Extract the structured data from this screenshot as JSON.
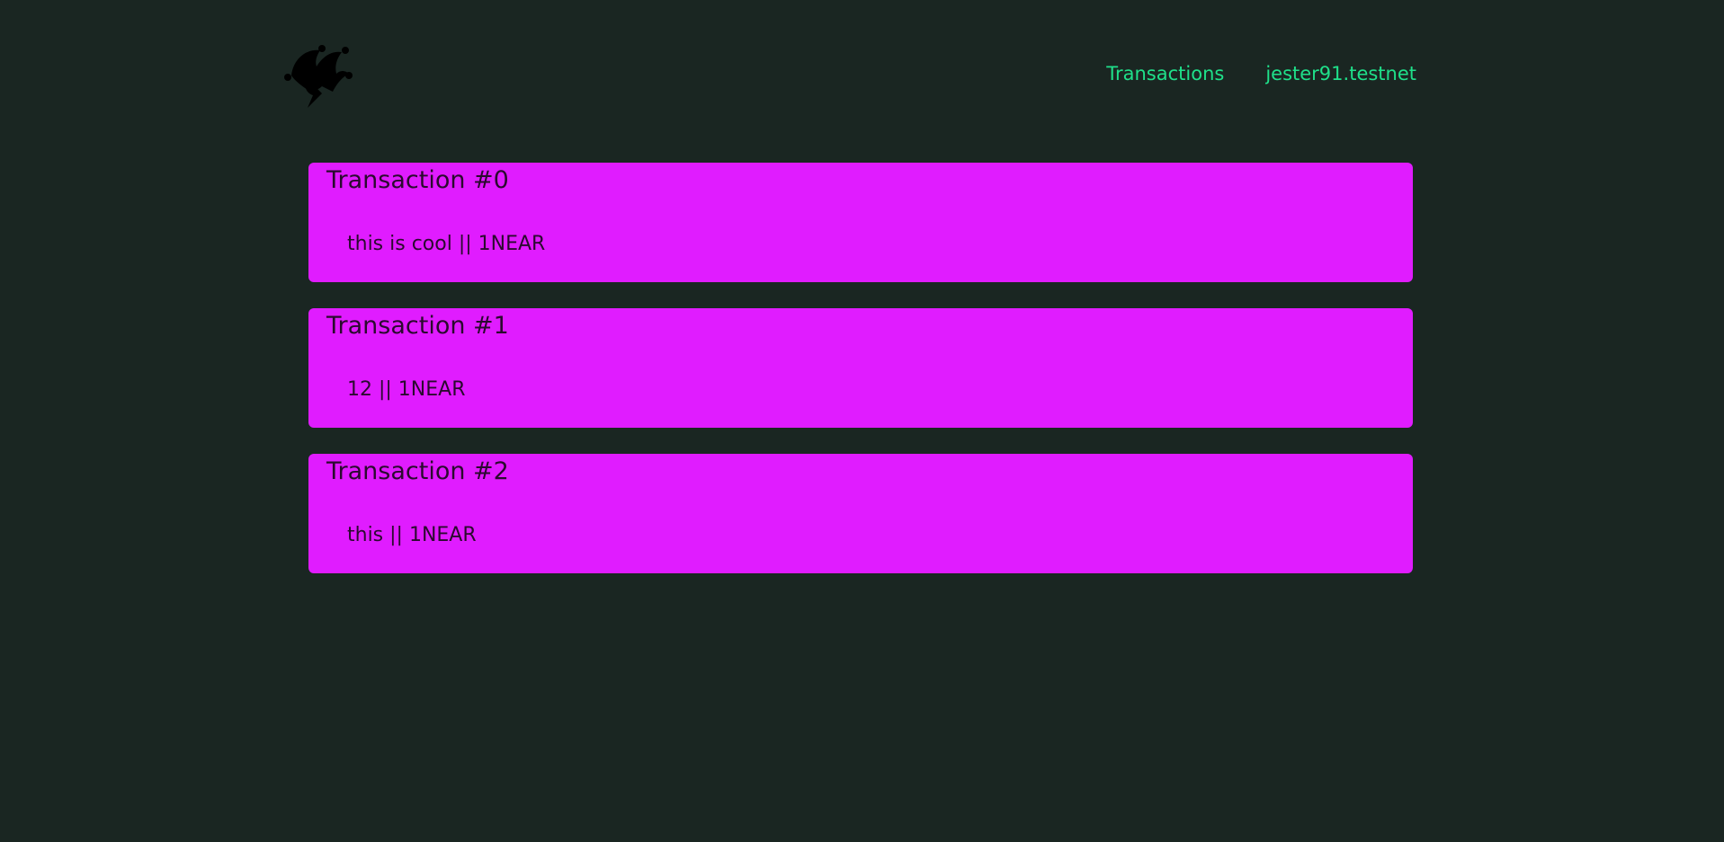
{
  "header": {
    "logo_icon": "jester-hat-icon",
    "nav": {
      "transactions_label": "Transactions",
      "account_label": "jester91.testnet"
    },
    "link_color": "#1fe08a"
  },
  "transactions": [
    {
      "title": "Transaction #0",
      "body": "this is cool || 1NEAR"
    },
    {
      "title": "Transaction #1",
      "body": "12 || 1NEAR"
    },
    {
      "title": "Transaction #2",
      "body": "this || 1NEAR"
    }
  ],
  "colors": {
    "background": "#1a2622",
    "card": "#e01cff",
    "card_text": "#2a0a2e"
  }
}
